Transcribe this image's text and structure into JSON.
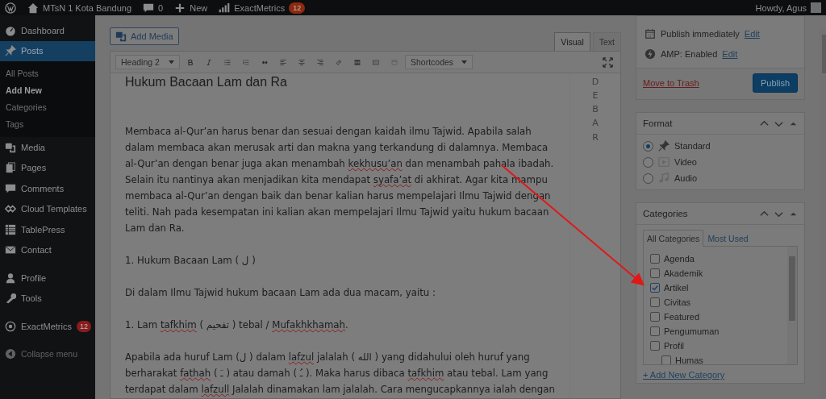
{
  "admin_bar": {
    "site": "MTsN 1 Kota Bandung",
    "comments": "0",
    "new": "New",
    "plugin": "ExactMetrics",
    "plugin_badge": "12",
    "greeting": "Howdy, Agus"
  },
  "sidebar": {
    "groups": [
      [
        {
          "label": "Dashboard",
          "kind": "gauge",
          "selected": false
        },
        {
          "label": "Posts",
          "kind": "pin",
          "selected": true,
          "children": [
            {
              "label": "All Posts",
              "selected": false
            },
            {
              "label": "Add New",
              "selected": true
            },
            {
              "label": "Categories",
              "selected": false
            },
            {
              "label": "Tags",
              "selected": false
            }
          ]
        },
        {
          "label": "Media",
          "kind": "media",
          "selected": false
        },
        {
          "label": "Pages",
          "kind": "pages",
          "selected": false
        },
        {
          "label": "Comments",
          "kind": "comment",
          "selected": false
        },
        {
          "label": "Cloud Templates",
          "kind": "cloud",
          "selected": false
        },
        {
          "label": "TablePress",
          "kind": "table",
          "selected": false
        },
        {
          "label": "Contact",
          "kind": "mail",
          "selected": false
        }
      ],
      [
        {
          "label": "Profile",
          "kind": "user",
          "selected": false
        },
        {
          "label": "Tools",
          "kind": "wrench",
          "selected": false
        }
      ],
      [
        {
          "label": "ExactMetrics",
          "kind": "metrics",
          "selected": false,
          "badge": "12"
        }
      ]
    ],
    "collapse": "Collapse menu"
  },
  "editor": {
    "add_media": "Add Media",
    "tabs": [
      {
        "label": "Visual",
        "selected": true
      },
      {
        "label": "Text",
        "selected": false
      }
    ],
    "format_select": "Heading 2",
    "shortcodes_select": "Shortcodes",
    "heading": "Hukum Bacaan Lam dan Ra",
    "side_letters": "DEBAR",
    "paragraphs": [
      {
        "parts": [
          {
            "text": "Membaca al-Qur’an harus benar dan sesuai dengan kaidah ilmu Tajwid. Apabila salah dalam membaca akan merusak arti dan makna yang terkandung di dalamnya. Membaca al-Qur’an dengan benar juga akan menambah ",
            "misspelled": false
          },
          {
            "text": "kekhusu’an",
            "misspelled": true
          },
          {
            "text": " dan menambah pahala ibadah. Selain itu nantinya akan menjadikan kita mendapat ",
            "misspelled": false
          },
          {
            "text": "syafa’at",
            "misspelled": true
          },
          {
            "text": " di akhirat. Agar kita mampu membaca al-Qur’an dengan baik dan benar kalian harus mempelajari Ilmu Tajwid dengan teliti. Nah pada kesempatan ini kalian akan mempelajari Ilmu Tajwid yaitu hukum bacaan Lam dan Ra.",
            "misspelled": false
          }
        ]
      },
      {
        "parts": [
          {
            "text": "1. Hukum Bacaan Lam (  ل  )",
            "misspelled": false
          }
        ]
      },
      {
        "parts": [
          {
            "text": " Di dalam Ilmu Tajwid hukum bacaan Lam  ada dua macam, yaitu :",
            "misspelled": false
          }
        ]
      },
      {
        "parts": [
          {
            "text": "1. Lam ",
            "misspelled": false
          },
          {
            "text": "tafkhim",
            "misspelled": true
          },
          {
            "text": " ( تفحيم ) tebal / ",
            "misspelled": false
          },
          {
            "text": "Mufakhkhamah",
            "misspelled": true
          },
          {
            "text": ".",
            "misspelled": false
          }
        ]
      },
      {
        "parts": [
          {
            "text": "Apabila ada huruf Lam (ل ) dalam  ",
            "misspelled": false
          },
          {
            "text": "lafzul",
            "misspelled": true
          },
          {
            "text": "  jalalah ( الله ) yang didahului oleh huruf yang berharakat ",
            "misspelled": false
          },
          {
            "text": "fathah",
            "misspelled": true
          },
          {
            "text": " ( ـَ ) atau damah ( ـُ ). Maka harus dibaca ",
            "misspelled": false
          },
          {
            "text": "tafkhim",
            "misspelled": true
          },
          {
            "text": " atau tebal. Lam yang terdapat dalam ",
            "misspelled": false
          },
          {
            "text": "lafzull",
            "misspelled": true
          },
          {
            "text": " Jalalah dinamakan lam jalalah. Cara mengucapkannya ialah dengan",
            "misspelled": false
          }
        ]
      }
    ]
  },
  "publish": {
    "rows": [
      {
        "kind": "calendar",
        "label": "Publish ",
        "bold": "immediately",
        "link": "Edit"
      },
      {
        "kind": "bolt",
        "label": "AMP: Enabled",
        "link": "Edit"
      }
    ],
    "trash": "Move to Trash",
    "button": "Publish"
  },
  "format": {
    "title": "Format",
    "options": [
      {
        "label": "Standard",
        "kind": "pin",
        "selected": true
      },
      {
        "label": "Video",
        "kind": "video",
        "selected": false
      },
      {
        "label": "Audio",
        "kind": "audio",
        "selected": false
      }
    ]
  },
  "categories": {
    "title": "Categories",
    "tabs": [
      {
        "label": "All Categories",
        "selected": true
      },
      {
        "label": "Most Used",
        "selected": false
      }
    ],
    "items": [
      {
        "label": "Agenda",
        "checked": false
      },
      {
        "label": "Akademik",
        "checked": false
      },
      {
        "label": "Artikel",
        "checked": true
      },
      {
        "label": "Civitas",
        "checked": false
      },
      {
        "label": "Featured",
        "checked": false
      },
      {
        "label": "Pengumuman",
        "checked": false
      },
      {
        "label": "Profil",
        "checked": false,
        "children": [
          {
            "label": "Humas",
            "checked": false
          }
        ]
      }
    ],
    "add_new": "+ Add New Category"
  }
}
